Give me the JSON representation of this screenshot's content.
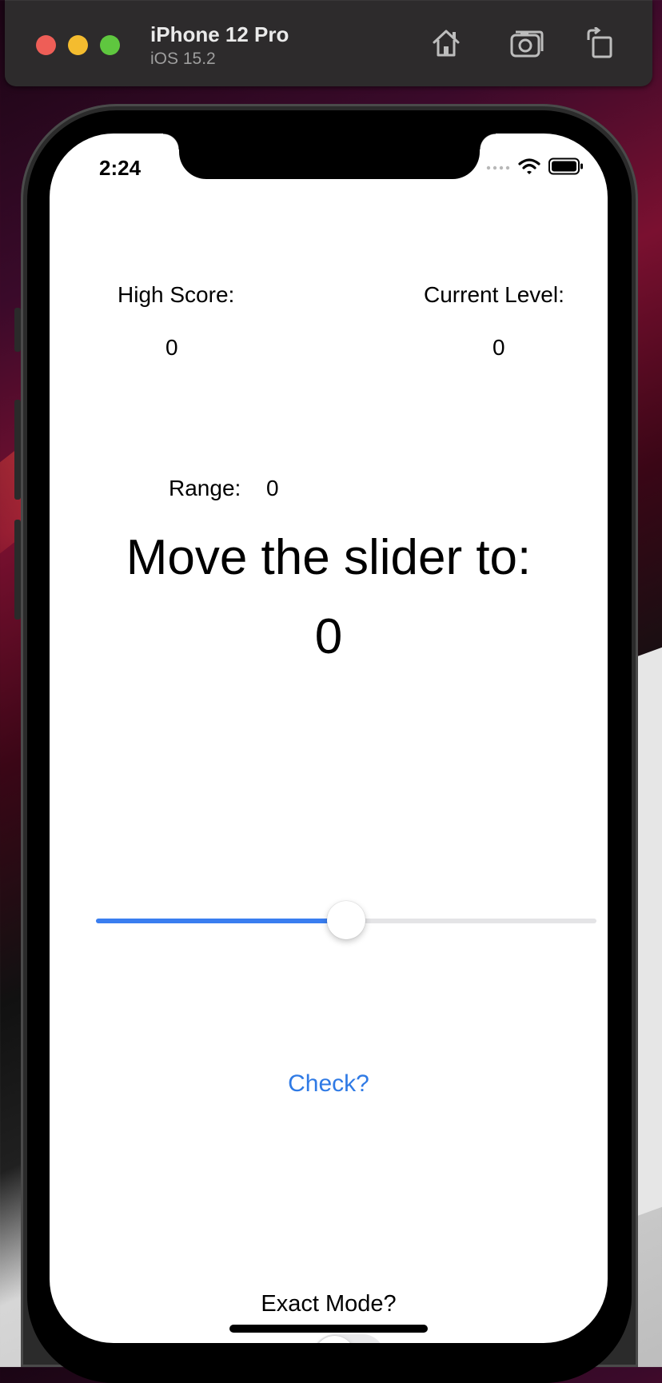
{
  "simulator": {
    "device_name": "iPhone 12 Pro",
    "os_version": "iOS 15.2",
    "buttons": [
      "home-icon",
      "screenshot-icon",
      "rotate-icon"
    ]
  },
  "status_bar": {
    "time": "2:24"
  },
  "game": {
    "high_score_label": "High Score:",
    "high_score_value": "0",
    "current_level_label": "Current Level:",
    "current_level_value": "0",
    "range_label": "Range:",
    "range_value": "0",
    "prompt": "Move the slider to:",
    "target_value": "0",
    "slider_position": 0.5,
    "check_button": "Check?",
    "exact_mode_label": "Exact Mode?",
    "exact_mode_on": false
  },
  "colors": {
    "accent": "#3a7ef0",
    "link": "#2f7ae5",
    "track": "#e4e4e6"
  }
}
